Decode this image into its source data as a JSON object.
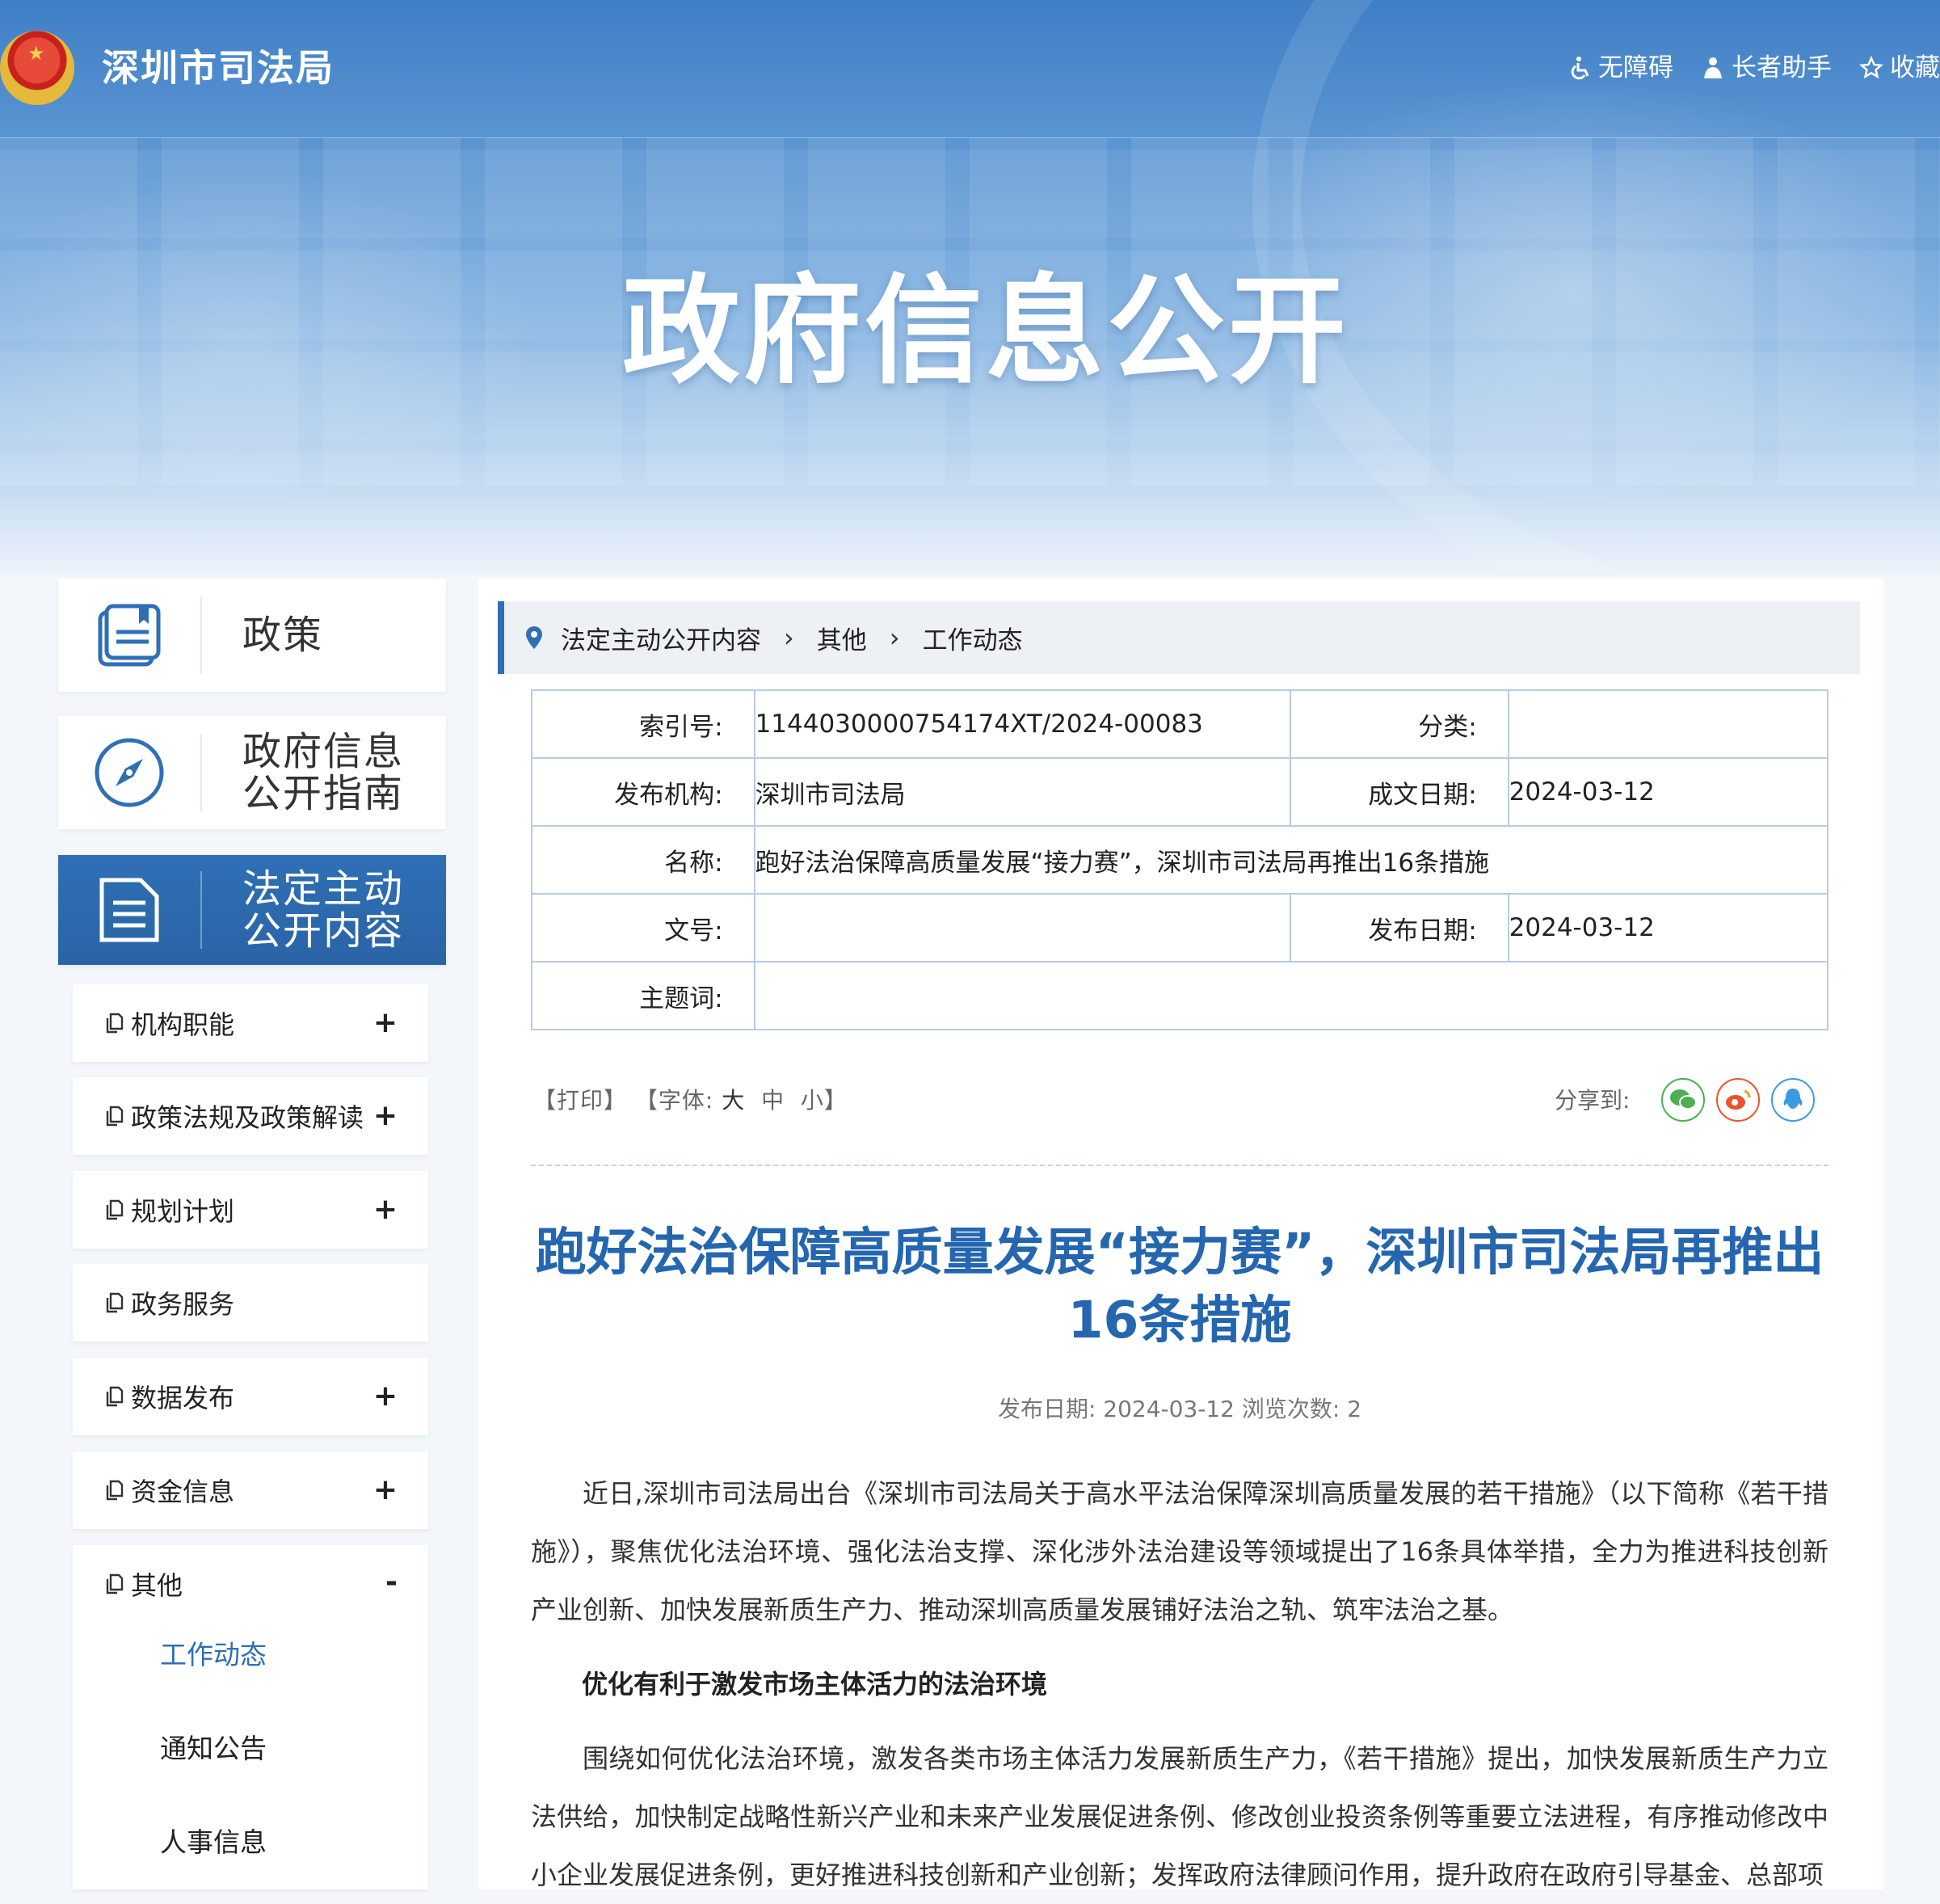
{
  "header": {
    "site_name": "深圳市司法局",
    "links": [
      "无障碍",
      "长者助手",
      "收藏"
    ],
    "hero_title": "政府信息公开"
  },
  "sidebar": {
    "cards": [
      {
        "label": "政策",
        "icon": "book-icon"
      },
      {
        "label_lines": [
          "政府信息",
          "公开指南"
        ],
        "icon": "compass-icon"
      },
      {
        "label_lines": [
          "法定主动",
          "公开内容"
        ],
        "icon": "document-icon",
        "active": true
      }
    ],
    "items": [
      {
        "label": "机构职能",
        "toggle": "+"
      },
      {
        "label": "政策法规及政策解读",
        "toggle": "+"
      },
      {
        "label": "规划计划",
        "toggle": "+"
      },
      {
        "label": "政务服务",
        "toggle": ""
      },
      {
        "label": "数据发布",
        "toggle": "+"
      },
      {
        "label": "资金信息",
        "toggle": "+"
      }
    ],
    "group": {
      "label": "其他",
      "toggle": "-",
      "children": [
        "工作动态",
        "通知公告",
        "人事信息"
      ],
      "active_child": "工作动态"
    }
  },
  "breadcrumb": [
    "法定主动公开内容",
    "其他",
    "工作动态"
  ],
  "meta": {
    "index_label": "索引号:",
    "index_value": "1144030000754174XT/2024-00083",
    "category_label": "分类:",
    "category_value": "",
    "agency_label": "发布机构:",
    "agency_value": "深圳市司法局",
    "created_label": "成文日期:",
    "created_value": "2024-03-12",
    "name_label": "名称:",
    "name_value": "跑好法治保障高质量发展“接力赛”，深圳市司法局再推出16条措施",
    "docno_label": "文号:",
    "docno_value": "",
    "published_label": "发布日期:",
    "published_value": "2024-03-12",
    "keywords_label": "主题词:",
    "keywords_value": ""
  },
  "tools": {
    "print": "【打印】",
    "font_prefix": "【字体:",
    "font_large": "大",
    "font_medium": "中",
    "font_small": "小】",
    "share_label": "分享到:"
  },
  "article": {
    "title": "跑好法治保障高质量发展“接力赛”，深圳市司法局再推出16条措施",
    "pubinfo": "发布日期: 2024-03-12  浏览次数: 2",
    "p1": "近日,深圳市司法局出台《深圳市司法局关于高水平法治保障深圳高质量发展的若干措施》（以下简称《若干措施》），聚焦优化法治环境、强化法治支撑、深化涉外法治建设等领域提出了16条具体举措，全力为推进科技创新产业创新、加快发展新质生产力、推动深圳高质量发展铺好法治之轨、筑牢法治之基。",
    "h1": "优化有利于激发市场主体活力的法治环境",
    "p2": "围绕如何优化法治环境，激发各类市场主体活力发展新质生产力，《若干措施》提出，加快发展新质生产力立法供给，加快制定战略性新兴产业和未来产业发展促进条例、修改创业投资条例等重要立法进程，有序推动修改中小企业发展促进条例，更好推进科技创新和产业创新；发挥政府法律顾问作用，提升政府在政府引导基金、总部项"
  },
  "colors": {
    "accent": "#2f6fb5",
    "title": "#2466b0",
    "wechat": "#4caf50",
    "weibo": "#e8542f",
    "qq": "#3a9be0"
  }
}
